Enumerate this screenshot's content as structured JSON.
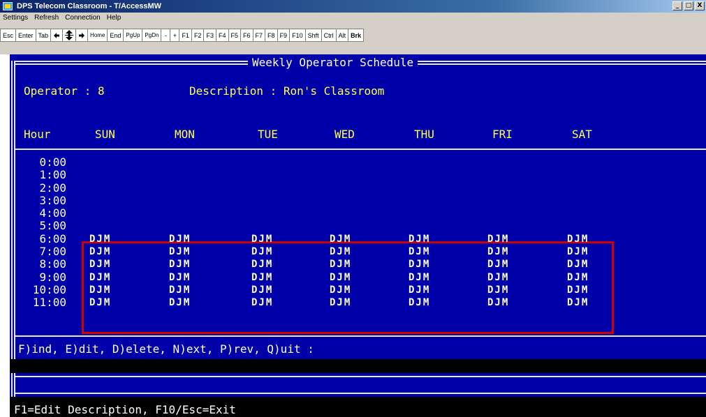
{
  "window": {
    "title": "DPS Telecom Classroom - T/AccessMW",
    "controls": [
      "_",
      "□",
      "X"
    ]
  },
  "menu": [
    "Settings",
    "Refresh",
    "Connection",
    "Help"
  ],
  "keys": [
    "Esc",
    "Enter",
    "Tab",
    "←",
    "↕",
    "→",
    "Home",
    "End",
    "PgUp",
    "PgDn",
    "-",
    "+",
    "F1",
    "F2",
    "F3",
    "F4",
    "F5",
    "F6",
    "F7",
    "F8",
    "F9",
    "F10",
    "Shft",
    "Ctrl",
    "Alt",
    "Brk"
  ],
  "screen": {
    "title": "Weekly Operator Schedule",
    "operator_label": "Operator : 8",
    "description_label": "Description : Ron's Classroom",
    "hour_header": "Hour",
    "days": [
      "SUN",
      "MON",
      "TUE",
      "WED",
      "THU",
      "FRI",
      "SAT"
    ],
    "hours": [
      "0:00",
      "1:00",
      "2:00",
      "3:00",
      "4:00",
      "5:00",
      "6:00",
      "7:00",
      "8:00",
      "9:00",
      "10:00",
      "11:00"
    ],
    "schedule_start_hour_index": 6,
    "schedule": [
      [
        "DJM",
        "DJM",
        "DJM",
        "DJM",
        "DJM",
        "DJM",
        "DJM"
      ],
      [
        "DJM",
        "DJM",
        "DJM",
        "DJM",
        "DJM",
        "DJM",
        "DJM"
      ],
      [
        "DJM",
        "DJM",
        "DJM",
        "DJM",
        "DJM",
        "DJM",
        "DJM"
      ],
      [
        "DJM",
        "DJM",
        "DJM",
        "DJM",
        "DJM",
        "DJM",
        "DJM"
      ],
      [
        "DJM",
        "DJM",
        "DJM",
        "DJM",
        "DJM",
        "DJM",
        "DJM"
      ],
      [
        "DJM",
        "DJM",
        "DJM",
        "DJM",
        "DJM",
        "DJM",
        "DJM"
      ]
    ],
    "prompt": "F)ind, E)dit, D)elete, N)ext, P)rev, Q)uit :",
    "footer": "F1=Edit Description, F10/Esc=Exit"
  },
  "colors": {
    "panel_blue": "#0000a8",
    "header_yellow": "#ffff55",
    "highlight_red": "#d00000"
  }
}
